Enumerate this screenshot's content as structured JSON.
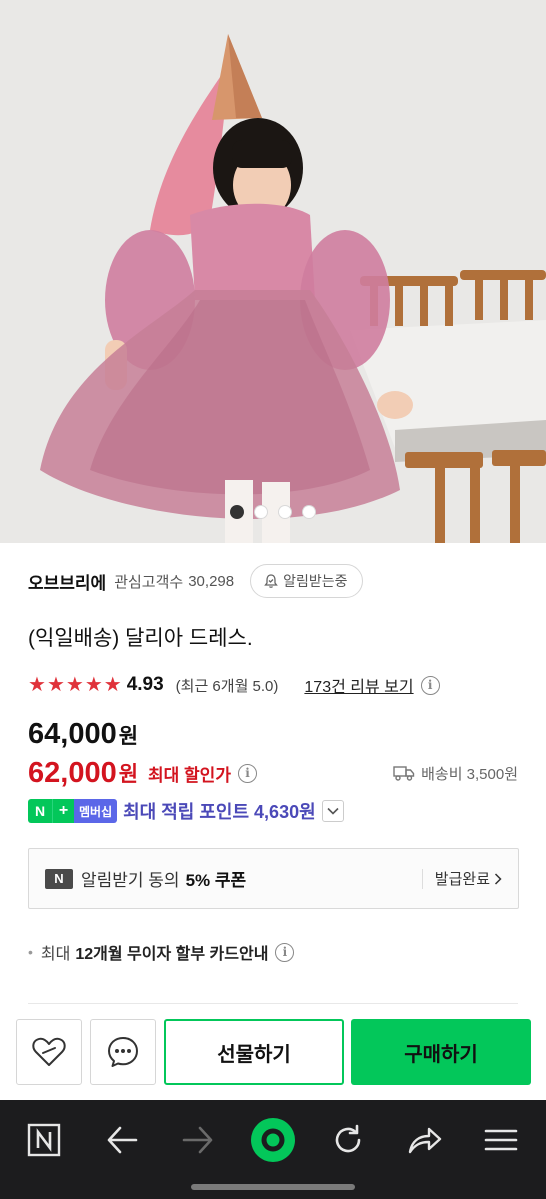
{
  "gallery": {
    "image_alt": "Girl in pink tulle dress wearing party hat",
    "total_slides": 4,
    "active_slide": 1
  },
  "store": {
    "name": "오브브리에",
    "interest_label": "관심고객수",
    "interest_count": "30,298",
    "alarm_label": "알림받는중"
  },
  "product": {
    "title": "(익일배송) 달리아 드레스.",
    "rating_stars": 5,
    "rating": "4.93",
    "recent_rating": "(최근 6개월 5.0)",
    "review_link": "173건 리뷰 보기"
  },
  "price": {
    "original": "64,000",
    "original_unit": "원",
    "sale": "62,000",
    "sale_unit": "원",
    "sale_label": "최대 할인가",
    "shipping": "배송비 3,500원"
  },
  "points": {
    "badge_n": "N",
    "badge_plus": "+",
    "badge_membership": "멤버십",
    "text": "최대 적립 포인트 4,630원"
  },
  "coupon": {
    "icon": "N",
    "text": "알림받기 동의",
    "bold": "5% 쿠폰",
    "status": "발급완료"
  },
  "card": {
    "prefix": "최대",
    "bold": "12개월 무이자 할부 카드안내"
  },
  "actions": {
    "like_icon": "heart-icon",
    "chat_icon": "chat-icon",
    "gift_label": "선물하기",
    "buy_label": "구매하기"
  },
  "colors": {
    "accent_green": "#03c75a",
    "sale_red": "#d3141f",
    "point_purple": "#4b49b8",
    "star_red": "#e0323a"
  },
  "browser_nav": [
    "naver-home-icon",
    "back-icon",
    "forward-icon",
    "green-dot-icon",
    "refresh-icon",
    "share-icon",
    "menu-icon"
  ]
}
